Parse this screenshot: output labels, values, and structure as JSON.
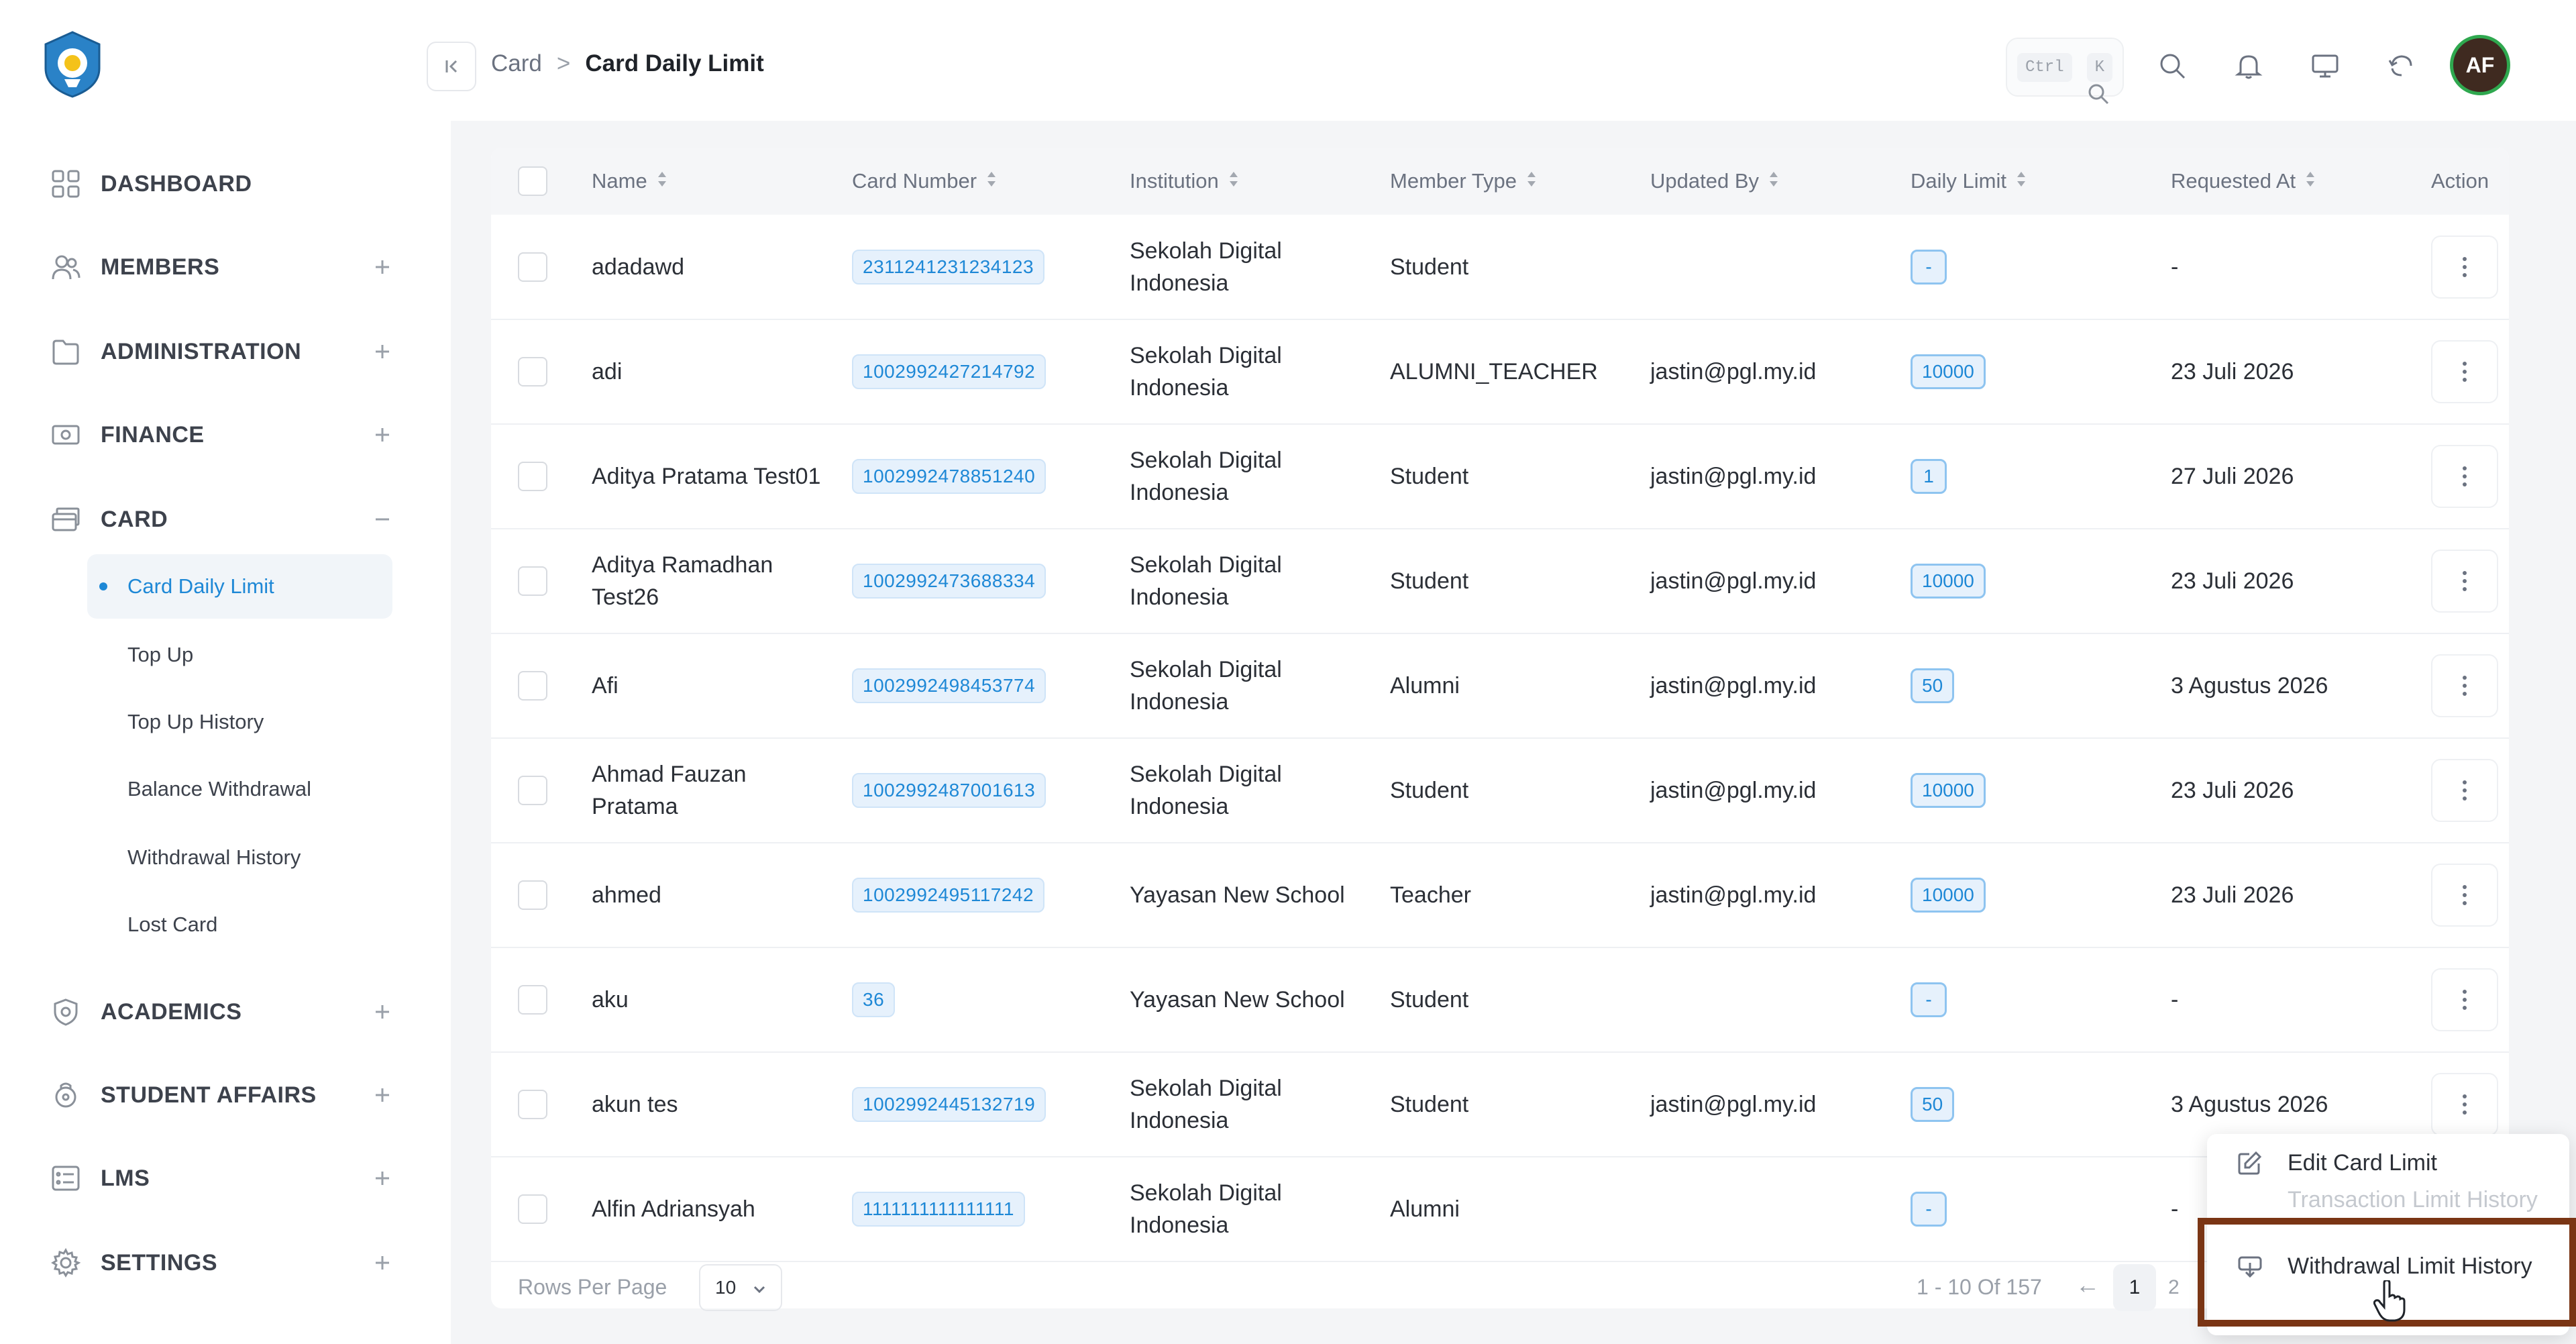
{
  "sidebar": {
    "logo": "tut-wuri-handayani-logo",
    "nav": [
      {
        "label": "DASHBOARD",
        "icon": "grid-icon",
        "toggle": ""
      },
      {
        "label": "MEMBERS",
        "icon": "users-icon",
        "toggle": "+"
      },
      {
        "label": "ADMINISTRATION",
        "icon": "folder-icon",
        "toggle": "+"
      },
      {
        "label": "FINANCE",
        "icon": "banknote-icon",
        "toggle": "+"
      },
      {
        "label": "CARD",
        "icon": "cards-icon",
        "toggle": "−"
      },
      {
        "label": "ACADEMICS",
        "icon": "shield-icon",
        "toggle": "+"
      },
      {
        "label": "STUDENT AFFAIRS",
        "icon": "lock-icon",
        "toggle": "+"
      },
      {
        "label": "LMS",
        "icon": "list-icon",
        "toggle": "+"
      },
      {
        "label": "SETTINGS",
        "icon": "gear-icon",
        "toggle": "+"
      }
    ],
    "card_sub": [
      {
        "label": "Card Daily Limit",
        "active": true
      },
      {
        "label": "Top Up"
      },
      {
        "label": "Top Up History"
      },
      {
        "label": "Balance Withdrawal"
      },
      {
        "label": "Withdrawal History"
      },
      {
        "label": "Lost Card"
      }
    ]
  },
  "header": {
    "breadcrumb_parent": "Card",
    "breadcrumb_sep": ">",
    "breadcrumb_current": "Card Daily Limit",
    "kbd_ctrl": "Ctrl",
    "kbd_k": "K",
    "avatar_initials": "AF"
  },
  "table": {
    "columns": [
      "Name",
      "Card Number",
      "Institution",
      "Member Type",
      "Updated By",
      "Daily Limit",
      "Requested At",
      "Action"
    ],
    "rows": [
      {
        "name": "adadawd",
        "card": "2311241231234123",
        "inst": "Sekolah Digital Indonesia",
        "type": "Student",
        "updated": "",
        "limit": "-",
        "requested": "-"
      },
      {
        "name": "adi",
        "card": "1002992427214792",
        "inst": "Sekolah Digital Indonesia",
        "type": "ALUMNI_TEACHER",
        "updated": "jastin@pgl.my.id",
        "limit": "10000",
        "requested": "23 Juli 2026"
      },
      {
        "name": "Aditya Pratama Test01",
        "card": "1002992478851240",
        "inst": "Sekolah Digital Indonesia",
        "type": "Student",
        "updated": "jastin@pgl.my.id",
        "limit": "1",
        "requested": "27 Juli 2026"
      },
      {
        "name": "Aditya Ramadhan Test26",
        "card": "1002992473688334",
        "inst": "Sekolah Digital Indonesia",
        "type": "Student",
        "updated": "jastin@pgl.my.id",
        "limit": "10000",
        "requested": "23 Juli 2026"
      },
      {
        "name": "Afi",
        "card": "1002992498453774",
        "inst": "Sekolah Digital Indonesia",
        "type": "Alumni",
        "updated": "jastin@pgl.my.id",
        "limit": "50",
        "requested": "3 Agustus 2026"
      },
      {
        "name": "Ahmad Fauzan Pratama",
        "card": "1002992487001613",
        "inst": "Sekolah Digital Indonesia",
        "type": "Student",
        "updated": "jastin@pgl.my.id",
        "limit": "10000",
        "requested": "23 Juli 2026"
      },
      {
        "name": "ahmed",
        "card": "1002992495117242",
        "inst": "Yayasan New School",
        "type": "Teacher",
        "updated": "jastin@pgl.my.id",
        "limit": "10000",
        "requested": "23 Juli 2026"
      },
      {
        "name": "aku",
        "card": "36",
        "inst": "Yayasan New School",
        "type": "Student",
        "updated": "",
        "limit": "-",
        "requested": "-"
      },
      {
        "name": "akun tes",
        "card": "1002992445132719",
        "inst": "Sekolah Digital Indonesia",
        "type": "Student",
        "updated": "jastin@pgl.my.id",
        "limit": "50",
        "requested": "3 Agustus 2026"
      },
      {
        "name": "Alfin Adriansyah",
        "card": "1111111111111111",
        "inst": "Sekolah Digital Indonesia",
        "type": "Alumni",
        "updated": "",
        "limit": "-",
        "requested": "-"
      }
    ]
  },
  "footer": {
    "rows_per_page_label": "Rows Per Page",
    "rows_per_page_value": "10",
    "range_text": "1 - 10 Of 157",
    "prev_arrow": "←",
    "current_page": "1",
    "next_page_partial": "2"
  },
  "action_menu": {
    "items": [
      {
        "label": "Edit Card Limit",
        "icon": "edit-icon"
      },
      {
        "label": "Transaction Limit History",
        "icon": "history-icon"
      },
      {
        "label": "Withdrawal Limit History",
        "icon": "withdraw-icon"
      }
    ]
  },
  "colors": {
    "accent": "#1e88d6",
    "tag_bg": "#e6f1fc",
    "highlight_border": "#7a3514",
    "avatar_ring": "#2fa84f"
  }
}
